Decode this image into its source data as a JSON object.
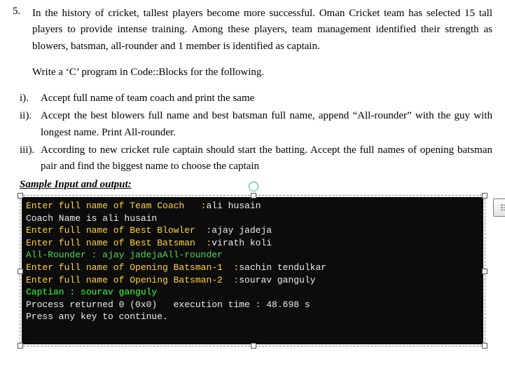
{
  "question": {
    "number": "5.",
    "prompt": "In the history of cricket, tallest players become more successful. Oman Cricket team has selected 15 tall players to provide intense training. Among these players, team management identified their strength as blowers, batsman, all-rounder and 1 member is identified as captain.",
    "instruction": "Write a ‘C’ program in Code::Blocks for the following.",
    "parts": {
      "i_label": "i).",
      "i_text": "Accept full name of team coach and print the same",
      "ii_label": "ii).",
      "ii_text": "Accept the best blowers full name and best batsman full name, append “All-rounder” with the guy with longest name. Print All-rounder.",
      "iii_label": "iii).",
      "iii_text": "According to new cricket rule captain should start the batting. Accept the full names of opening batsman pair and find the biggest name to choose the captain"
    },
    "sample_title": "Sample Input and output:"
  },
  "terminal": {
    "l1a": "Enter full name of Team Coach   :",
    "l1b": "ali husain",
    "l2": "Coach Name is ali husain",
    "l3a": "Enter full name of Best Blowler  :",
    "l3b": "ajay jadeja",
    "l4a": "Enter full name of Best Batsman  :",
    "l4b": "virath koli",
    "l5": "All-Rounder : ajay jadejaAll-rounder",
    "l6a": "Enter full name of Opening Batsman-1  :",
    "l6b": "sachin tendulkar",
    "l7a": "Enter full name of Opening Batsman-2  :",
    "l7b": "sourav ganguly",
    "l8": "Captian : sourav ganguly",
    "l9": "Process returned 0 (0x0)   execution time : 48.698 s",
    "l10": "Press any key to continue."
  },
  "icons": {
    "layout": "☷"
  }
}
